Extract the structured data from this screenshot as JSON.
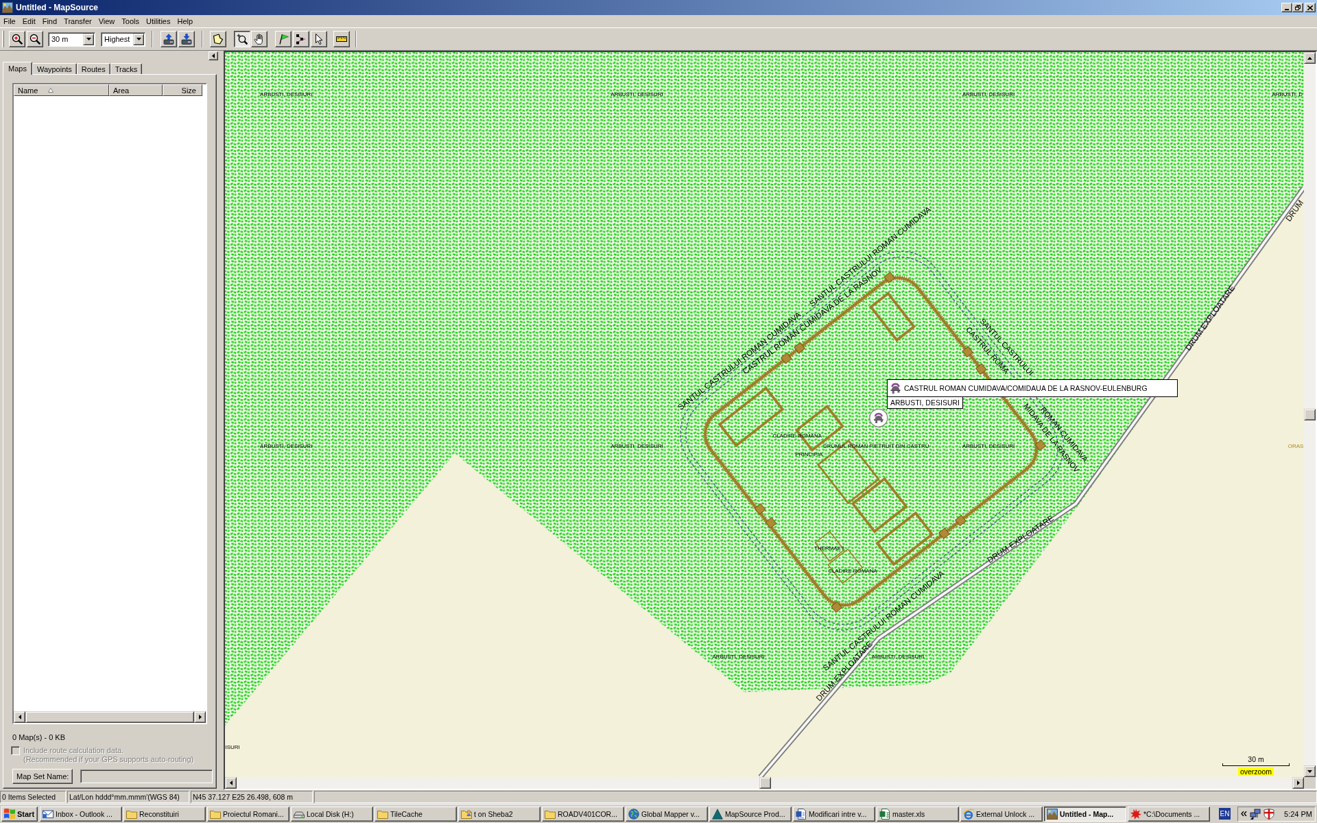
{
  "window": {
    "title": "Untitled - MapSource"
  },
  "menu": [
    "File",
    "Edit",
    "Find",
    "Transfer",
    "View",
    "Tools",
    "Utilities",
    "Help"
  ],
  "toolbar": {
    "zoom": [
      {
        "kind": "zoomin"
      },
      {
        "kind": "zoomout"
      }
    ],
    "scale_select": "30 m",
    "detail_select": "Highest",
    "transfer": [
      {
        "kind": "receive"
      },
      {
        "kind": "send"
      }
    ],
    "tools": [
      {
        "kind": "area",
        "selected": false
      },
      {
        "kind": "zoom",
        "selected": true
      },
      {
        "kind": "hand",
        "selected": false
      },
      {
        "kind": "flag",
        "selected": false
      },
      {
        "kind": "route",
        "selected": false
      },
      {
        "kind": "pointer",
        "selected": false
      },
      {
        "kind": "ruler",
        "selected": false
      }
    ]
  },
  "sidebar": {
    "tabs": [
      {
        "label": "Maps",
        "selected": true
      },
      {
        "label": "Waypoints",
        "selected": false
      },
      {
        "label": "Routes",
        "selected": false
      },
      {
        "label": "Tracks",
        "selected": false
      }
    ],
    "columns": [
      {
        "label": "Name",
        "sorted": true
      },
      {
        "label": "Area",
        "sorted": false
      },
      {
        "label": "Size",
        "sorted": false
      }
    ],
    "summary": "0 Map(s) - 0 KB",
    "route_option": {
      "label": "Include route calculation data.",
      "note": "(Recommended if your GPS supports auto-routing)",
      "checked": false,
      "disabled": true
    },
    "map_set": {
      "button": "Map Set Name:",
      "disabled": true
    }
  },
  "map": {
    "area_labels": [
      "ARBUSTI, DESISURI",
      "ARBUSTI, DESISURI",
      "ARBUSTI, DESISURI",
      "ARBUSTI, D",
      "ARBUSTI, DESISURI",
      "ARBUSTI, DESISURI",
      "ARBUSTI, DESISURI",
      "ARBUSTI, DESISURI",
      "ARBUSTI, DESISURI",
      "ISURI"
    ],
    "town_label": "ORAS",
    "line_labels": [
      "SANTUL CASTRULUI ROMAN CUMIDAVA",
      "SANTUL CASTRULUI ROMAN CUMIDAVA",
      "CASTRUL ROMAN CUMIDAVA DE LA RASNOV",
      "SANTUL CASTRULUI",
      "ROMAN CUMIDAVA",
      "CASTRUL ROMA",
      "MIDAVA DE LA RASNOV",
      "SANTUL CASTRULUI ROMAN CUMIDAVA",
      "DRUM EXPLOATARE",
      "DRUM EXPLOATARE",
      "DRUM EXPLOATARE",
      "DRUM"
    ],
    "feature_labels": [
      "CLADIRE ROMANA",
      "PRINCIPIA",
      "DRUMUL ROMAN PIETRUIT DIN CASTRU",
      "THERMAE?",
      "CLADIRE ROMANA"
    ],
    "poi": {
      "name": "CASTRUL ROMAN CUMIDAVA/COMIDAUA DE LA RASNOV-EULENBURG",
      "area": "ARBUSTI, DESISURI"
    },
    "scale": {
      "distance": "30 m",
      "note": "overzoom"
    }
  },
  "status_bar": [
    "0 Items Selected",
    "Lat/Lon hddd°mm.mmm'(WGS 84)",
    "N45 37.127 E25 26.498, 608 m"
  ],
  "taskbar": {
    "start": "Start",
    "items": [
      {
        "label": "Inbox - Outlook ...",
        "kind": "mail",
        "selected": false
      },
      {
        "label": "Reconstituiri",
        "kind": "folder",
        "selected": false
      },
      {
        "label": "Proiectul Romani...",
        "kind": "folder",
        "selected": false
      },
      {
        "label": "Local Disk (H:)",
        "kind": "drive",
        "selected": false
      },
      {
        "label": "TileCache",
        "kind": "folder",
        "selected": false
      },
      {
        "label": "t on Sheba2",
        "kind": "share",
        "selected": false
      },
      {
        "label": "ROADV401COR...",
        "kind": "folder",
        "selected": false
      },
      {
        "label": "Global Mapper v...",
        "kind": "globe",
        "selected": false
      },
      {
        "label": "MapSource Prod...",
        "kind": "triangle",
        "selected": false
      },
      {
        "label": "Modificari intre v...",
        "kind": "doc",
        "selected": false
      },
      {
        "label": "master.xls",
        "kind": "sheet",
        "selected": false
      },
      {
        "label": "External Unlock ...",
        "kind": "browser",
        "selected": false
      },
      {
        "label": "Untitled - Map...",
        "kind": "map",
        "selected": true
      },
      {
        "label": "*C:\\Documents ...",
        "kind": "splat",
        "selected": false
      }
    ],
    "language": "EN",
    "clock": "5:24 PM"
  }
}
